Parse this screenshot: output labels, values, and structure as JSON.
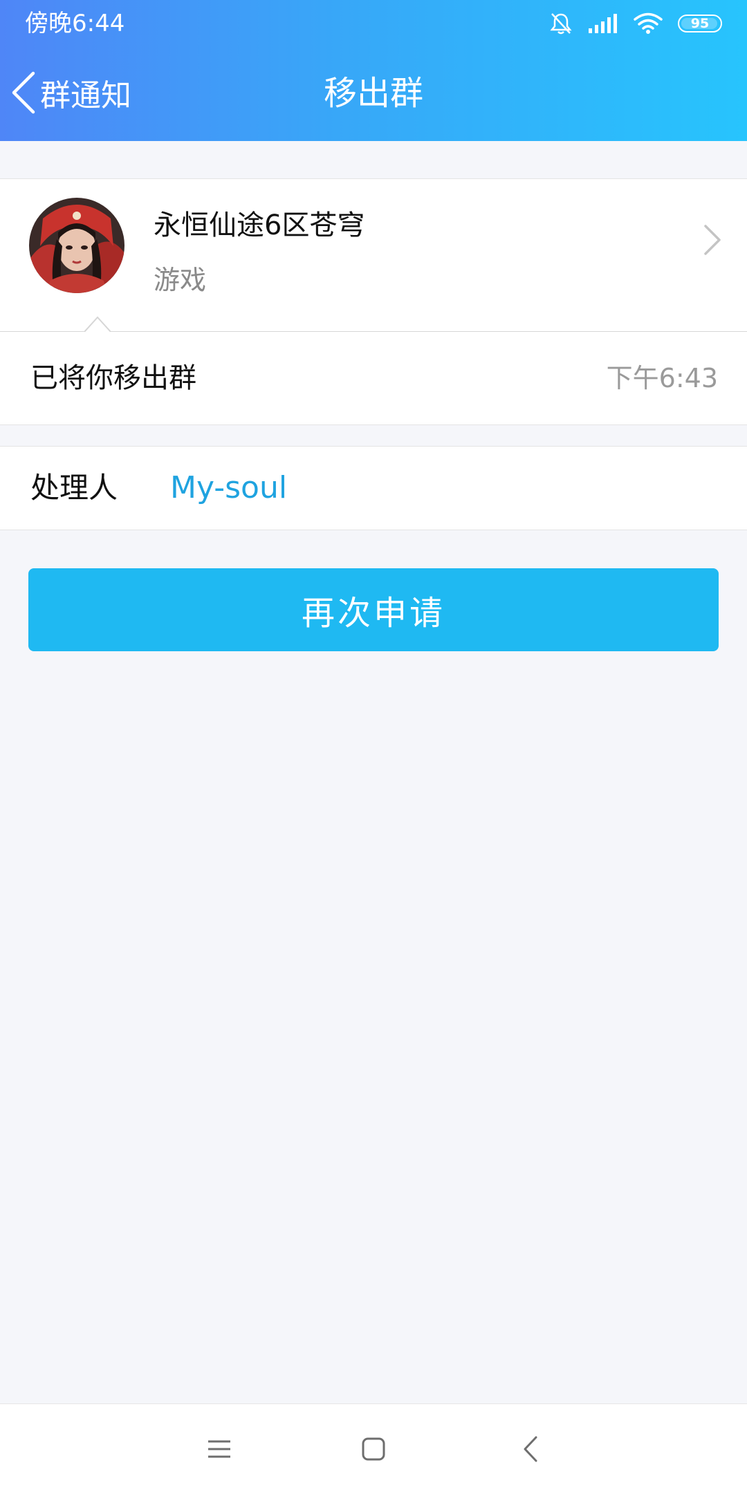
{
  "status_bar": {
    "time": "傍晚6:44",
    "battery": "95"
  },
  "header": {
    "back_label": "群通知",
    "title": "移出群"
  },
  "group": {
    "name": "永恒仙途6区苍穹",
    "category": "游戏"
  },
  "notice": {
    "message": "已将你移出群",
    "time": "下午6:43"
  },
  "handler": {
    "label": "处理人",
    "name": "My-soul"
  },
  "actions": {
    "reapply_label": "再次申请"
  },
  "colors": {
    "header_gradient_start": "#4f86f7",
    "header_gradient_end": "#27c4fd",
    "button": "#1fb9f2",
    "link": "#1fa3e0"
  }
}
